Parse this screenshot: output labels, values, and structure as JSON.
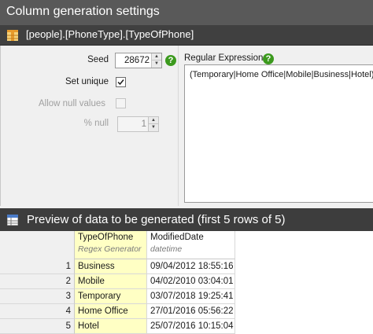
{
  "window": {
    "title": "Column generation settings",
    "column_path": "[people].[PhoneType].[TypeOfPhone]"
  },
  "settings": {
    "seed_label": "Seed",
    "seed_value": "28672",
    "set_unique_label": "Set unique",
    "set_unique_checked": true,
    "allow_null_label": "Allow null values",
    "allow_null_checked": false,
    "percent_null_label": "% null",
    "percent_null_value": "1",
    "regex_label": "Regular Expression:",
    "regex_value": "(Temporary|Home Office|Mobile|Business|Hotel)"
  },
  "preview": {
    "title": "Preview of data to be generated (first 5 rows of 5)",
    "columns": [
      {
        "name": "TypeOfPhone",
        "subtitle": "Regex Generator"
      },
      {
        "name": "ModifiedDate",
        "subtitle": "datetime"
      }
    ],
    "rows": [
      {
        "num": "1",
        "type": "Business",
        "date": "09/04/2012 18:55:16"
      },
      {
        "num": "2",
        "type": "Mobile",
        "date": "04/02/2010 03:04:01"
      },
      {
        "num": "3",
        "type": "Temporary",
        "date": "03/07/2018 19:25:41"
      },
      {
        "num": "4",
        "type": "Home Office",
        "date": "27/01/2016 05:56:22"
      },
      {
        "num": "5",
        "type": "Hotel",
        "date": "25/07/2016 10:15:04"
      }
    ]
  },
  "colors": {
    "title_bg": "#595959",
    "column_bar_bg": "#404040",
    "preview_bar_bg": "#3d3d3d",
    "generated_column_highlight": "#ffffc4",
    "help_icon": "#3c9a1e"
  },
  "icons": {
    "column": "table-column-icon",
    "help": "help-icon",
    "preview": "preview-table-icon"
  }
}
